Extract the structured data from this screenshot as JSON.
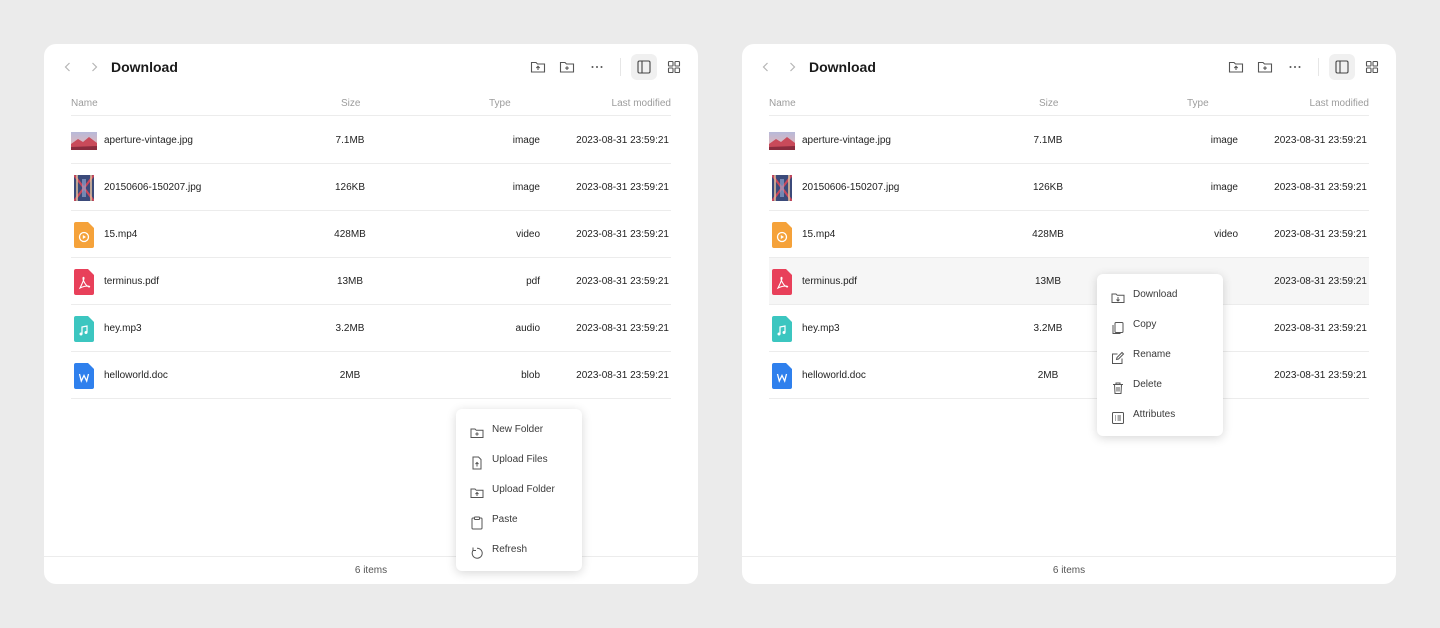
{
  "panels": [
    {
      "title": "Download",
      "columns": {
        "name": "Name",
        "size": "Size",
        "type": "Type",
        "modified": "Last modified"
      },
      "files": [
        {
          "name": "aperture-vintage.jpg",
          "size": "7.1MB",
          "type": "image",
          "modified": "2023-08-31 23:59:21",
          "icon": "image-thumbnail-landscape"
        },
        {
          "name": "20150606-150207.jpg",
          "size": "126KB",
          "type": "image",
          "modified": "2023-08-31 23:59:21",
          "icon": "image-thumbnail-building"
        },
        {
          "name": "15.mp4",
          "size": "428MB",
          "type": "video",
          "modified": "2023-08-31 23:59:21",
          "icon": "video-file-icon"
        },
        {
          "name": "terminus.pdf",
          "size": "13MB",
          "type": "pdf",
          "modified": "2023-08-31 23:59:21",
          "icon": "pdf-file-icon"
        },
        {
          "name": "hey.mp3",
          "size": "3.2MB",
          "type": "audio",
          "modified": "2023-08-31 23:59:21",
          "icon": "audio-file-icon"
        },
        {
          "name": "helloworld.doc",
          "size": "2MB",
          "type": "blob",
          "modified": "2023-08-31 23:59:21",
          "icon": "word-file-icon"
        }
      ],
      "footer": "6 items",
      "context_menu": [
        {
          "label": "New Folder",
          "icon": "new-folder-icon"
        },
        {
          "label": "Upload Files",
          "icon": "upload-file-icon"
        },
        {
          "label": "Upload Folder",
          "icon": "upload-folder-icon"
        },
        {
          "label": "Paste",
          "icon": "clipboard-icon"
        },
        {
          "label": "Refresh",
          "icon": "refresh-icon"
        }
      ]
    },
    {
      "title": "Download",
      "columns": {
        "name": "Name",
        "size": "Size",
        "type": "Type",
        "modified": "Last modified"
      },
      "files": [
        {
          "name": "aperture-vintage.jpg",
          "size": "7.1MB",
          "type": "image",
          "modified": "2023-08-31 23:59:21",
          "icon": "image-thumbnail-landscape"
        },
        {
          "name": "20150606-150207.jpg",
          "size": "126KB",
          "type": "image",
          "modified": "2023-08-31 23:59:21",
          "icon": "image-thumbnail-building"
        },
        {
          "name": "15.mp4",
          "size": "428MB",
          "type": "video",
          "modified": "2023-08-31 23:59:21",
          "icon": "video-file-icon"
        },
        {
          "name": "terminus.pdf",
          "size": "13MB",
          "type": "",
          "modified": "2023-08-31 23:59:21",
          "icon": "pdf-file-icon"
        },
        {
          "name": "hey.mp3",
          "size": "3.2MB",
          "type": "",
          "modified": "2023-08-31 23:59:21",
          "icon": "audio-file-icon"
        },
        {
          "name": "helloworld.doc",
          "size": "2MB",
          "type": "",
          "modified": "2023-08-31 23:59:21",
          "icon": "word-file-icon"
        }
      ],
      "footer": "6 items",
      "context_menu": [
        {
          "label": "Download",
          "icon": "download-icon"
        },
        {
          "label": "Copy",
          "icon": "copy-icon"
        },
        {
          "label": "Rename",
          "icon": "edit-icon"
        },
        {
          "label": "Delete",
          "icon": "trash-icon"
        },
        {
          "label": "Attributes",
          "icon": "attributes-icon"
        }
      ]
    }
  ],
  "colors": {
    "background": "#ebebeb",
    "panel": "#ffffff",
    "video": "#f5a23a",
    "pdf": "#e8405a",
    "audio": "#3cc6c0",
    "word": "#2f80ed"
  }
}
